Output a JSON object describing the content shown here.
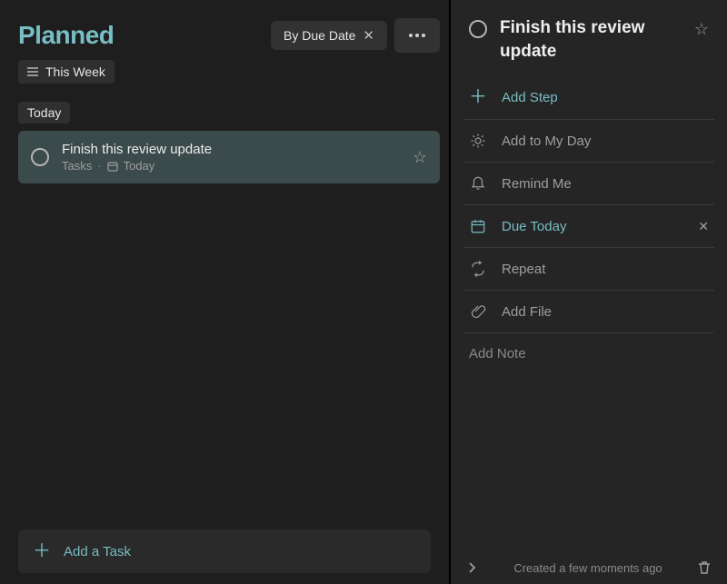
{
  "colors": {
    "accent": "#78bcc4"
  },
  "main": {
    "title": "Planned",
    "sort_chip": "By Due Date",
    "filter_chip": "This Week",
    "section_label": "Today",
    "task": {
      "title": "Finish this review update",
      "list_name": "Tasks",
      "due_label": "Today"
    },
    "add_task_placeholder": "Add a Task"
  },
  "detail": {
    "title": "Finish this review update",
    "add_step": "Add Step",
    "add_my_day": "Add to My Day",
    "remind": "Remind Me",
    "due": "Due Today",
    "repeat": "Repeat",
    "add_file": "Add File",
    "note_placeholder": "Add Note",
    "created_meta": "Created a few moments ago"
  }
}
